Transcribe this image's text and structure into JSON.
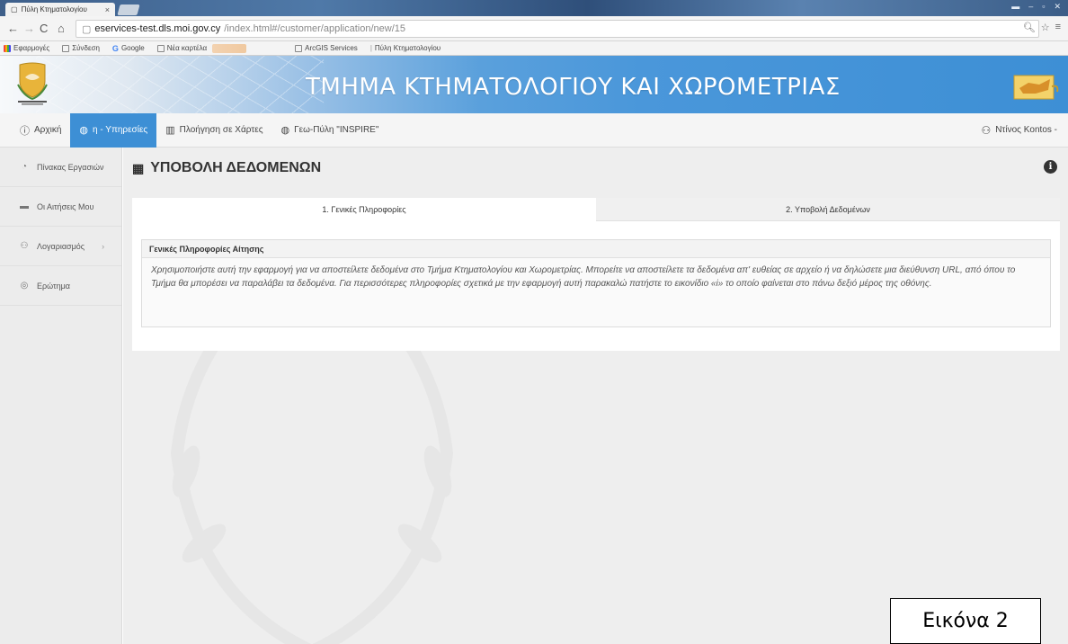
{
  "browser": {
    "tab_title": "Πύλη Κτηματολογίου",
    "tab_close": "×",
    "url_host": "eservices-test.dls.moi.gov.cy",
    "url_path": "/index.html#/customer/application/new/15",
    "bookmarks": [
      {
        "label": "Εφαρμογές",
        "icon": "apps-icon"
      },
      {
        "label": "Σύνδεση",
        "icon": "page-icon"
      },
      {
        "label": "Google",
        "icon": "google-icon"
      },
      {
        "label": "Νέα καρτέλα",
        "icon": "page-icon"
      },
      {
        "label": "ArcGIS Services",
        "icon": "page-icon"
      },
      {
        "label": "Πύλη Κτηματολογίου",
        "icon": "page-icon"
      }
    ]
  },
  "header": {
    "title": "ΤΜΗΜΑ ΚΤΗΜΑΤΟΛΟΓΙΟΥ ΚΑΙ ΧΩΡΟΜΕΤΡΙΑΣ",
    "color": "#3d8fd5"
  },
  "nav": {
    "items": [
      {
        "label": "Αρχική",
        "icon": "info-circle-icon",
        "active": false
      },
      {
        "label": "η - Υπηρεσίες",
        "icon": "globe-icon",
        "active": true
      },
      {
        "label": "Πλοήγηση σε Χάρτες",
        "icon": "book-map-icon",
        "active": false
      },
      {
        "label": "Γεω-Πύλη \"INSPIRE\"",
        "icon": "globe-icon",
        "active": false
      }
    ],
    "user": "Nτίνος Kontos -"
  },
  "sidebar": {
    "items": [
      {
        "label": "Πίνακας Εργασιών",
        "icon": "dashboard-icon"
      },
      {
        "label": "Οι Αιτήσεις Μου",
        "icon": "folder-icon"
      },
      {
        "label": "Λογαριασμός",
        "icon": "user-icon",
        "chevron": "›"
      },
      {
        "label": "Ερώτημα",
        "icon": "question-icon"
      }
    ]
  },
  "main": {
    "page_title": "ΥΠΟΒΟΛΗ ΔΕΔΟΜΕΝΩΝ",
    "tabs": [
      {
        "label": "1. Γενικές Πληροφορίες",
        "active": true
      },
      {
        "label": "2. Υποβολή Δεδομένων",
        "active": false
      }
    ],
    "info_header": "Γενικές Πληροφορίες Αίτησης",
    "info_body": "Χρησιμοποιήστε αυτή την εφαρμογή για να αποστείλετε δεδομένα στο Τμήμα Κτηματολογίου και Χωρομετρίας. Μπορείτε να αποστείλετε τα δεδομένα απ' ευθείας σε αρχείο ή να δηλώσετε μια διεύθυνση URL, από όπου το Τμήμα θα μπορέσει να παραλάβει τα δεδομένα. Για περισσότερες πληροφορίες σχετικά με την εφαρμογή αυτή παρακαλώ πατήστε το εικονίδιο «i» το οποίο φαίνεται στο πάνω δεξιό μέρος της οθόνης."
  },
  "caption": "Εικόνα 2"
}
